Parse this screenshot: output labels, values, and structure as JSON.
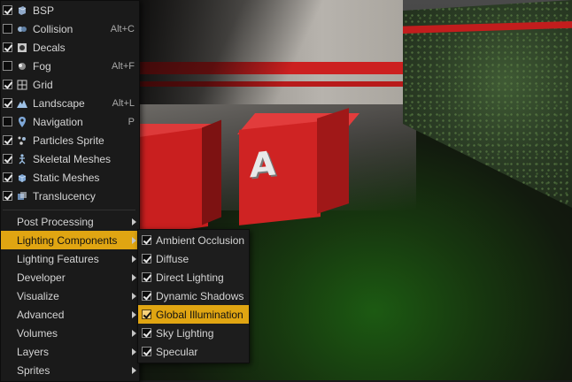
{
  "show_flags": [
    {
      "label": "BSP",
      "shortcut": "",
      "checked": true,
      "icon": "bsp-icon"
    },
    {
      "label": "Collision",
      "shortcut": "Alt+C",
      "checked": false,
      "icon": "collision-icon"
    },
    {
      "label": "Decals",
      "shortcut": "",
      "checked": true,
      "icon": "decals-icon"
    },
    {
      "label": "Fog",
      "shortcut": "Alt+F",
      "checked": false,
      "icon": "fog-icon"
    },
    {
      "label": "Grid",
      "shortcut": "",
      "checked": true,
      "icon": "grid-icon"
    },
    {
      "label": "Landscape",
      "shortcut": "Alt+L",
      "checked": true,
      "icon": "landscape-icon"
    },
    {
      "label": "Navigation",
      "shortcut": "P",
      "checked": false,
      "icon": "navigation-icon"
    },
    {
      "label": "Particles Sprite",
      "shortcut": "",
      "checked": true,
      "icon": "particles-icon"
    },
    {
      "label": "Skeletal Meshes",
      "shortcut": "",
      "checked": true,
      "icon": "skeletal-mesh-icon"
    },
    {
      "label": "Static Meshes",
      "shortcut": "",
      "checked": true,
      "icon": "static-mesh-icon"
    },
    {
      "label": "Translucency",
      "shortcut": "",
      "checked": true,
      "icon": "translucency-icon"
    }
  ],
  "submenus": [
    {
      "label": "Post Processing",
      "active": false
    },
    {
      "label": "Lighting Components",
      "active": true
    },
    {
      "label": "Lighting Features",
      "active": false
    },
    {
      "label": "Developer",
      "active": false
    },
    {
      "label": "Visualize",
      "active": false
    },
    {
      "label": "Advanced",
      "active": false
    },
    {
      "label": "Volumes",
      "active": false
    },
    {
      "label": "Layers",
      "active": false
    },
    {
      "label": "Sprites",
      "active": false
    }
  ],
  "lighting_components": [
    {
      "label": "Ambient Occlusion",
      "checked": true,
      "active": false
    },
    {
      "label": "Diffuse",
      "checked": true,
      "active": false
    },
    {
      "label": "Direct Lighting",
      "checked": true,
      "active": false
    },
    {
      "label": "Dynamic Shadows",
      "checked": true,
      "active": false
    },
    {
      "label": "Global Illumination",
      "checked": true,
      "active": true
    },
    {
      "label": "Sky Lighting",
      "checked": true,
      "active": false
    },
    {
      "label": "Specular",
      "checked": true,
      "active": false
    }
  ],
  "viewport": {
    "cube_glyph": "A"
  },
  "colors": {
    "highlight": "#e0a512",
    "menu_bg": "#1a1a1a",
    "menu_text": "#d4d4d4"
  }
}
